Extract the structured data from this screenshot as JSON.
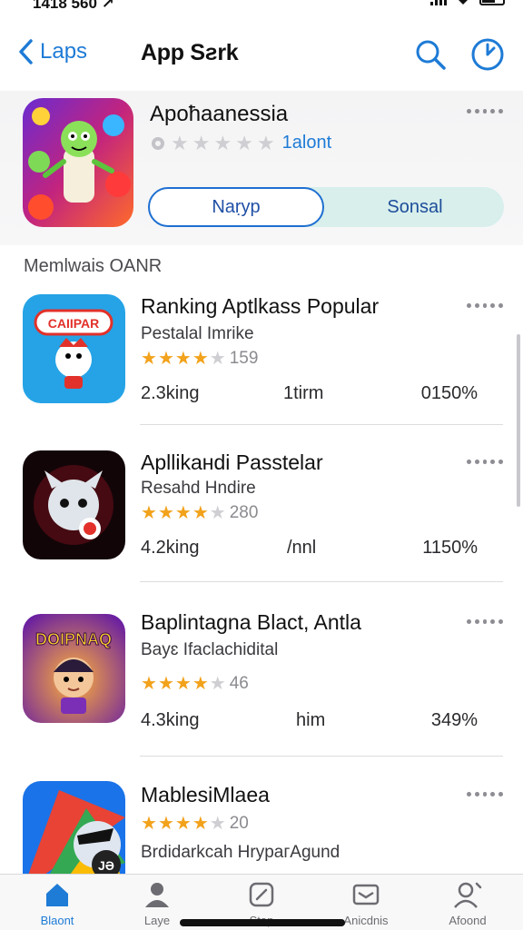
{
  "status_bar": {
    "time": "1418 560 ↗"
  },
  "nav": {
    "back_label": "Laps",
    "title": "App Sƨrk"
  },
  "featured": {
    "name": "Apoħaanessia",
    "rating_count": "1alont",
    "segment_left": "Naṛyp",
    "segment_right": "Sonsal"
  },
  "section": {
    "label": "Memlwais OANR"
  },
  "apps": [
    {
      "title": "Ranking Aptlkass Popular",
      "subtitle": "Pestalal Imrike",
      "stars": 4,
      "rating_count": "159",
      "meta_left": "2.3king",
      "meta_mid": "1tirm",
      "meta_right": "0150%"
    },
    {
      "title": "Apllikaнdi Passtelar",
      "subtitle": "Resahd Hndire",
      "stars": 4,
      "rating_count": "280",
      "meta_left": "4.2king",
      "meta_mid": "/nnl",
      "meta_right": "1150%"
    },
    {
      "title": "Baplintagna Blact, Antla",
      "subtitle": "Bayɛ Ifaclachidital",
      "stars": 3.5,
      "rating_count": "46",
      "meta_left": "4.3king",
      "meta_mid": "him",
      "meta_right": "349%"
    },
    {
      "title": "MablesiMlaea",
      "stars": 4,
      "rating_count": "20",
      "description": "Brdidarkcah HrypaгAgund"
    }
  ],
  "app_icon_labels": {
    "app1_banner": "CAIIPAR",
    "app3_banner": "DOIPNAQ",
    "app4_badge": "JƏ"
  },
  "tabs": [
    {
      "label": "Blaont",
      "icon": "home-icon",
      "active": true
    },
    {
      "label": "Laye",
      "icon": "person-icon",
      "active": false
    },
    {
      "label": "Stap",
      "icon": "edit-icon",
      "active": false
    },
    {
      "label": "Anicdnis",
      "icon": "inbox-icon",
      "active": false
    },
    {
      "label": "Afoond",
      "icon": "account-icon",
      "active": false
    }
  ],
  "colors": {
    "accent": "#1e7bd6",
    "star": "#f2a21b",
    "segment_bg": "#d8efec"
  }
}
